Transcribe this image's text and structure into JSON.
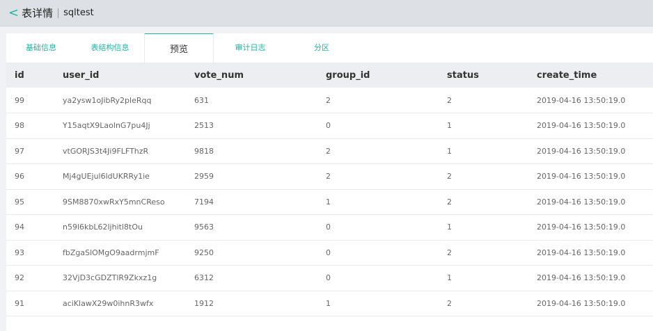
{
  "header": {
    "back_glyph": "<",
    "title": "表详情",
    "table_name": "sqltest"
  },
  "tabs": [
    "基础信息",
    "表结构信息",
    "预览",
    "审计日志",
    "分区"
  ],
  "active_tab": 2,
  "accent_color": "#1fb5a4",
  "table": {
    "columns": [
      "id",
      "user_id",
      "vote_num",
      "group_id",
      "status",
      "create_time"
    ],
    "rows": [
      [
        "99",
        "ya2ysw1oJibRy2pleRqq",
        "631",
        "2",
        "2",
        "2019-04-16 13:50:19.0"
      ],
      [
        "98",
        "Y15aqtX9LaolnG7pu4Jj",
        "2513",
        "0",
        "1",
        "2019-04-16 13:50:19.0"
      ],
      [
        "97",
        "vtGORJS3t4Ji9FLFThzR",
        "9818",
        "2",
        "1",
        "2019-04-16 13:50:19.0"
      ],
      [
        "96",
        "Mj4gUEjul6ldUKRRy1ie",
        "2959",
        "2",
        "2",
        "2019-04-16 13:50:19.0"
      ],
      [
        "95",
        "9SM8870xwRxY5mnCReso",
        "7194",
        "1",
        "2",
        "2019-04-16 13:50:19.0"
      ],
      [
        "94",
        "n59l6kbL62ljhitl8tOu",
        "9563",
        "0",
        "1",
        "2019-04-16 13:50:19.0"
      ],
      [
        "93",
        "fbZgaSlOMgO9aadrmjmF",
        "9250",
        "0",
        "2",
        "2019-04-16 13:50:19.0"
      ],
      [
        "92",
        "32VjD3cGDZTlR9Zkxz1g",
        "6312",
        "0",
        "1",
        "2019-04-16 13:50:19.0"
      ],
      [
        "91",
        "aciKlawX29w0ihnR3wfx",
        "1912",
        "1",
        "2",
        "2019-04-16 13:50:19.0"
      ]
    ]
  }
}
